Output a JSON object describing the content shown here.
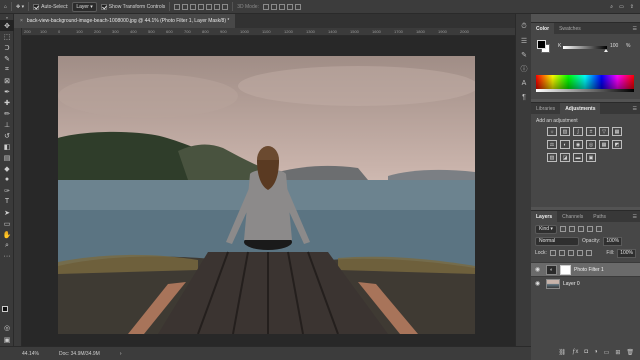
{
  "options_bar": {
    "auto_select_label": "Auto-Select:",
    "auto_select_value": "Layer",
    "show_transform_label": "Show Transform Controls",
    "mode_3d_label": "3D Mode:"
  },
  "document": {
    "tab_title": "back-view-background-image-beach-1008000.jpg @ 44.1% (Photo Filter 1, Layer Mask/8) *",
    "tab_close": "×"
  },
  "ruler": {
    "top_ticks": [
      "200",
      "100",
      "0",
      "100",
      "200",
      "300",
      "400",
      "500",
      "600",
      "700",
      "800",
      "900",
      "1000",
      "1100",
      "1200",
      "1300",
      "1400",
      "1500",
      "1600",
      "1700",
      "1800",
      "1900",
      "2000"
    ]
  },
  "status": {
    "zoom": "44.14%",
    "doc_size": "Doc: 34.9M/34.9M"
  },
  "color_panel": {
    "tabs": [
      "Color",
      "Swatches"
    ],
    "k_label": "K",
    "k_value": "100",
    "k_unit": "%"
  },
  "adjustments_panel": {
    "tabs": [
      "Libraries",
      "Adjustments"
    ],
    "add_label": "Add an adjustment",
    "icons": [
      "brightness-icon",
      "levels-icon",
      "curves-icon",
      "exposure-icon",
      "vibrance-icon",
      "hue-saturation-icon",
      "color-balance-icon",
      "black-white-icon",
      "photo-filter-icon",
      "channel-mixer-icon",
      "color-lookup-icon",
      "invert-icon",
      "posterize-icon",
      "threshold-icon",
      "gradient-map-icon",
      "selective-color-icon"
    ]
  },
  "layers_panel": {
    "tabs": [
      "Layers",
      "Channels",
      "Paths"
    ],
    "filter_kind": "Kind",
    "blend_mode": "Normal",
    "opacity_label": "Opacity:",
    "opacity_value": "100%",
    "lock_label": "Lock:",
    "fill_label": "Fill:",
    "fill_value": "100%",
    "layers": [
      {
        "name": "Photo Filter 1"
      },
      {
        "name": "Layer 0"
      }
    ]
  }
}
